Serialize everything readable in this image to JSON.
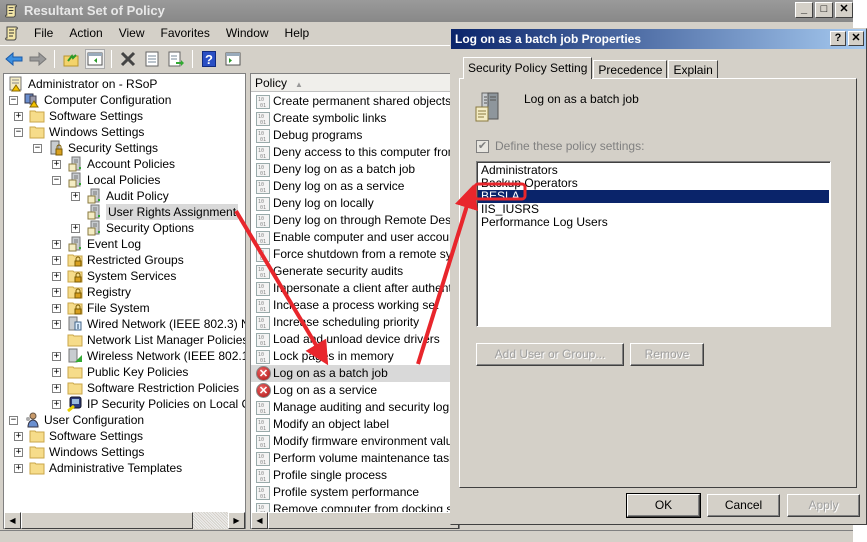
{
  "main_window": {
    "title": "Resultant Set of Policy",
    "title_icon": "scroll-icon",
    "controls": {
      "minimize": "_",
      "maximize": "□",
      "close": "✕"
    }
  },
  "menubar": {
    "items": [
      "File",
      "Action",
      "View",
      "Favorites",
      "Window",
      "Help"
    ]
  },
  "toolbar": {
    "buttons": [
      "back-arrow-icon",
      "forward-arrow-icon",
      "up-folder-icon",
      "show-hide-console-tree-icon",
      "delete-icon",
      "properties-icon",
      "export-list-icon",
      "help-icon",
      "show-action-pane-icon"
    ]
  },
  "tree": {
    "items": [
      {
        "label": "Administrator on  - RSoP",
        "level": 0,
        "expander": "none",
        "icon": "rsop-icon"
      },
      {
        "label": "Computer Configuration",
        "level": 0,
        "expander": "-",
        "icon": "computer-config-icon"
      },
      {
        "label": "Software Settings",
        "level": 1,
        "expander": "+",
        "icon": "folder-icon"
      },
      {
        "label": "Windows Settings",
        "level": 1,
        "expander": "-",
        "icon": "folder-icon"
      },
      {
        "label": "Security Settings",
        "level": 2,
        "expander": "-",
        "icon": "security-settings-icon"
      },
      {
        "label": "Account Policies",
        "level": 3,
        "expander": "+",
        "icon": "policy-node-icon"
      },
      {
        "label": "Local Policies",
        "level": 3,
        "expander": "-",
        "icon": "policy-node-icon"
      },
      {
        "label": "Audit Policy",
        "level": 4,
        "expander": "+",
        "icon": "policy-node-icon"
      },
      {
        "label": "User Rights Assignment",
        "level": 4,
        "expander": "none",
        "icon": "policy-node-icon",
        "selected": true
      },
      {
        "label": "Security Options",
        "level": 4,
        "expander": "+",
        "icon": "policy-node-icon"
      },
      {
        "label": "Event Log",
        "level": 3,
        "expander": "+",
        "icon": "policy-node-icon"
      },
      {
        "label": "Restricted Groups",
        "level": 3,
        "expander": "+",
        "icon": "locked-folder-icon"
      },
      {
        "label": "System Services",
        "level": 3,
        "expander": "+",
        "icon": "locked-folder-icon"
      },
      {
        "label": "Registry",
        "level": 3,
        "expander": "+",
        "icon": "locked-folder-icon"
      },
      {
        "label": "File System",
        "level": 3,
        "expander": "+",
        "icon": "locked-folder-icon"
      },
      {
        "label": "Wired Network (IEEE 802.3) N",
        "level": 3,
        "expander": "+",
        "icon": "wired-network-icon"
      },
      {
        "label": "Network List Manager Policies",
        "level": 3,
        "expander": "none",
        "icon": "folder-icon"
      },
      {
        "label": "Wireless Network (IEEE 802.1",
        "level": 3,
        "expander": "+",
        "icon": "wireless-network-icon"
      },
      {
        "label": "Public Key Policies",
        "level": 3,
        "expander": "+",
        "icon": "folder-icon"
      },
      {
        "label": "Software Restriction Policies",
        "level": 3,
        "expander": "+",
        "icon": "folder-icon"
      },
      {
        "label": "IP Security Policies on Local C",
        "level": 3,
        "expander": "+",
        "icon": "ip-security-icon"
      },
      {
        "label": "User Configuration",
        "level": 0,
        "expander": "-",
        "icon": "user-config-icon"
      },
      {
        "label": "Software Settings",
        "level": 1,
        "expander": "+",
        "icon": "folder-icon"
      },
      {
        "label": "Windows Settings",
        "level": 1,
        "expander": "+",
        "icon": "folder-icon"
      },
      {
        "label": "Administrative Templates",
        "level": 1,
        "expander": "+",
        "icon": "folder-icon"
      }
    ]
  },
  "policy_list": {
    "column_header": "Policy",
    "sort_indicator": "▲",
    "rows": [
      {
        "label": "Create permanent shared objects",
        "icon": "policy-icon"
      },
      {
        "label": "Create symbolic links",
        "icon": "policy-icon"
      },
      {
        "label": "Debug programs",
        "icon": "policy-icon"
      },
      {
        "label": "Deny access to this computer from the network",
        "icon": "policy-icon"
      },
      {
        "label": "Deny log on as a batch job",
        "icon": "policy-icon"
      },
      {
        "label": "Deny log on as a service",
        "icon": "policy-icon"
      },
      {
        "label": "Deny log on locally",
        "icon": "policy-icon"
      },
      {
        "label": "Deny log on through Remote Desktop Services",
        "icon": "policy-icon"
      },
      {
        "label": "Enable computer and user accounts to be trusted",
        "icon": "policy-icon"
      },
      {
        "label": "Force shutdown from a remote system",
        "icon": "policy-icon"
      },
      {
        "label": "Generate security audits",
        "icon": "policy-icon"
      },
      {
        "label": "Impersonate a client after authentication",
        "icon": "policy-icon"
      },
      {
        "label": "Increase a process working set",
        "icon": "policy-icon"
      },
      {
        "label": "Increase scheduling priority",
        "icon": "policy-icon"
      },
      {
        "label": "Load and unload device drivers",
        "icon": "policy-icon"
      },
      {
        "label": "Lock pages in memory",
        "icon": "policy-icon"
      },
      {
        "label": "Log on as a batch job",
        "icon": "error-icon",
        "selected": true
      },
      {
        "label": "Log on as a service",
        "icon": "error-icon"
      },
      {
        "label": "Manage auditing and security log",
        "icon": "policy-icon"
      },
      {
        "label": "Modify an object label",
        "icon": "policy-icon"
      },
      {
        "label": "Modify firmware environment values",
        "icon": "policy-icon"
      },
      {
        "label": "Perform volume maintenance tasks",
        "icon": "policy-icon"
      },
      {
        "label": "Profile single process",
        "icon": "policy-icon"
      },
      {
        "label": "Profile system performance",
        "icon": "policy-icon"
      },
      {
        "label": "Remove computer from docking station",
        "icon": "policy-icon"
      }
    ]
  },
  "dialog": {
    "title": "Log on as a batch job Properties",
    "controls": {
      "help": "?",
      "close": "✕"
    },
    "tabs": [
      {
        "label": "Security Policy Setting",
        "active": true
      },
      {
        "label": "Precedence",
        "active": false
      },
      {
        "label": "Explain",
        "active": false
      }
    ],
    "policy_name": "Log on as a batch job",
    "define_checkbox": {
      "label": "Define these policy settings:",
      "checked": true,
      "enabled": false
    },
    "members": [
      {
        "name": "Administrators"
      },
      {
        "name": "Backup Operators"
      },
      {
        "name": "BESLA",
        "selected": true,
        "highlighted": true
      },
      {
        "name": "IIS_IUSRS"
      },
      {
        "name": "Performance Log Users"
      }
    ],
    "add_button": "Add User or Group...",
    "remove_button": "Remove",
    "ok_button": "OK",
    "cancel_button": "Cancel",
    "apply_button": "Apply"
  },
  "annotations": {
    "color": "#e8262c",
    "arrows": [
      {
        "from": "User Rights Assignment",
        "to": "Log on as a batch job"
      },
      {
        "from": "Log on as a batch job",
        "to": "BESLA"
      }
    ],
    "highlight_box_on": "BESLA"
  }
}
